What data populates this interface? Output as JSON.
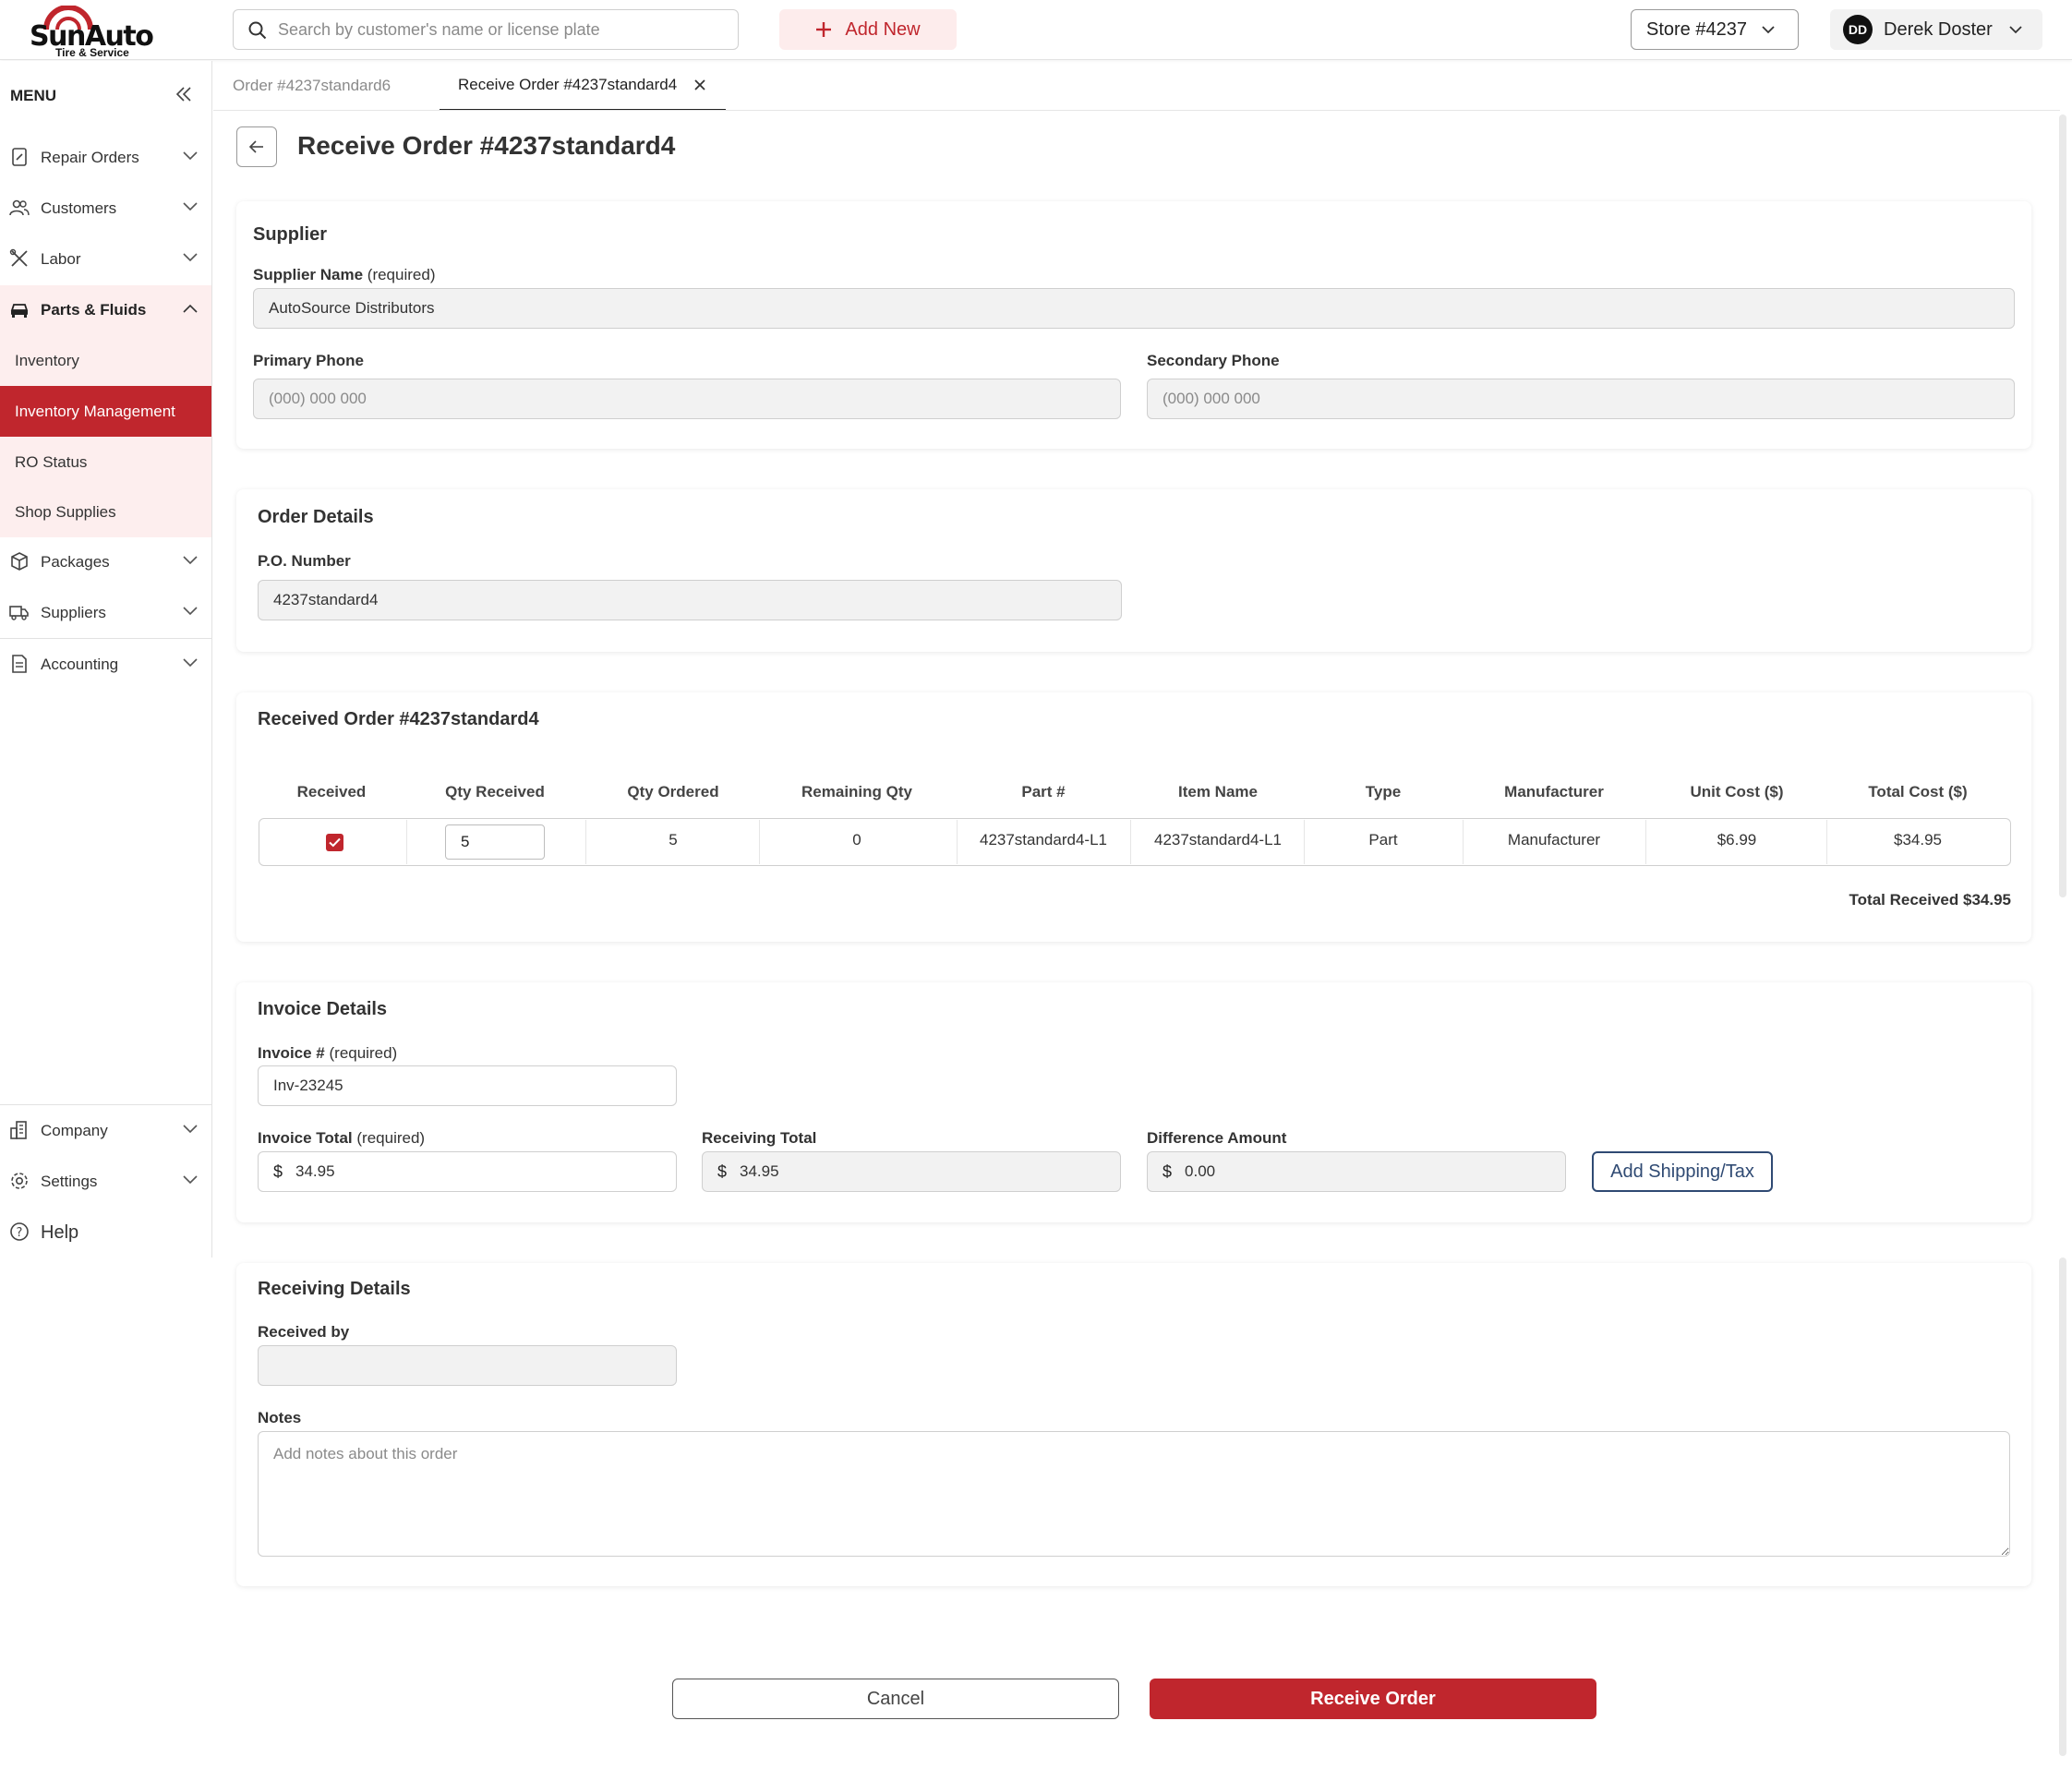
{
  "brand": {
    "name": "SunAuto",
    "tagline": "Tire & Service"
  },
  "header": {
    "search_placeholder": "Search by customer's name or license plate",
    "add_new": "Add New",
    "store": "Store #4237",
    "user_initials": "DD",
    "user_name": "Derek Doster"
  },
  "sidebar": {
    "menu_title": "MENU",
    "items": [
      {
        "label": "Repair Orders"
      },
      {
        "label": "Customers"
      },
      {
        "label": "Labor"
      },
      {
        "label": "Parts & Fluids"
      },
      {
        "label": "Packages"
      },
      {
        "label": "Suppliers"
      },
      {
        "label": "Accounting"
      }
    ],
    "sub_items": [
      {
        "label": "Inventory"
      },
      {
        "label": "Inventory Management",
        "active": true
      },
      {
        "label": "RO Status"
      },
      {
        "label": "Shop Supplies"
      }
    ],
    "bottom": [
      {
        "label": "Company"
      },
      {
        "label": "Settings"
      },
      {
        "label": "Help"
      }
    ]
  },
  "tabs": [
    {
      "label": "Order #4237standard6"
    },
    {
      "label": "Receive Order #4237standard4",
      "active": true
    }
  ],
  "page_title": "Receive Order #4237standard4",
  "supplier": {
    "heading": "Supplier",
    "name_label": "Supplier Name",
    "required": "(required)",
    "name_value": "AutoSource Distributors",
    "primary_phone_label": "Primary Phone",
    "primary_phone_placeholder": "(000) 000 000",
    "secondary_phone_label": "Secondary Phone",
    "secondary_phone_placeholder": "(000) 000 000"
  },
  "order_details": {
    "heading": "Order Details",
    "po_label": "P.O. Number",
    "po_value": "4237standard4"
  },
  "received": {
    "heading": "Received Order #4237standard4",
    "columns": [
      "Received",
      "Qty Received",
      "Qty Ordered",
      "Remaining Qty",
      "Part #",
      "Item Name",
      "Type",
      "Manufacturer",
      "Unit Cost ($)",
      "Total Cost ($)"
    ],
    "row": {
      "qty_received": "5",
      "qty_ordered": "5",
      "remaining": "0",
      "part": "4237standard4-L1",
      "item": "4237standard4-L1",
      "type": "Part",
      "manufacturer": "Manufacturer",
      "unit_cost": "$6.99",
      "total_cost": "$34.95"
    },
    "total_received": "Total Received $34.95"
  },
  "invoice": {
    "heading": "Invoice Details",
    "invoice_label": "Invoice #",
    "required": "(required)",
    "invoice_value": "Inv-23245",
    "total_label": "Invoice Total",
    "total_value": "34.95",
    "receiving_label": "Receiving Total",
    "receiving_value": "34.95",
    "difference_label": "Difference Amount",
    "difference_value": "0.00",
    "currency": "$",
    "add_shipping": "Add Shipping/Tax"
  },
  "receiving": {
    "heading": "Receiving Details",
    "received_by_label": "Received by",
    "notes_label": "Notes",
    "notes_placeholder": "Add notes about this order"
  },
  "actions": {
    "cancel": "Cancel",
    "receive": "Receive Order"
  },
  "colors": {
    "accent": "#c0262d",
    "accent_light": "#fdeeee",
    "navy": "#2f4a73"
  }
}
